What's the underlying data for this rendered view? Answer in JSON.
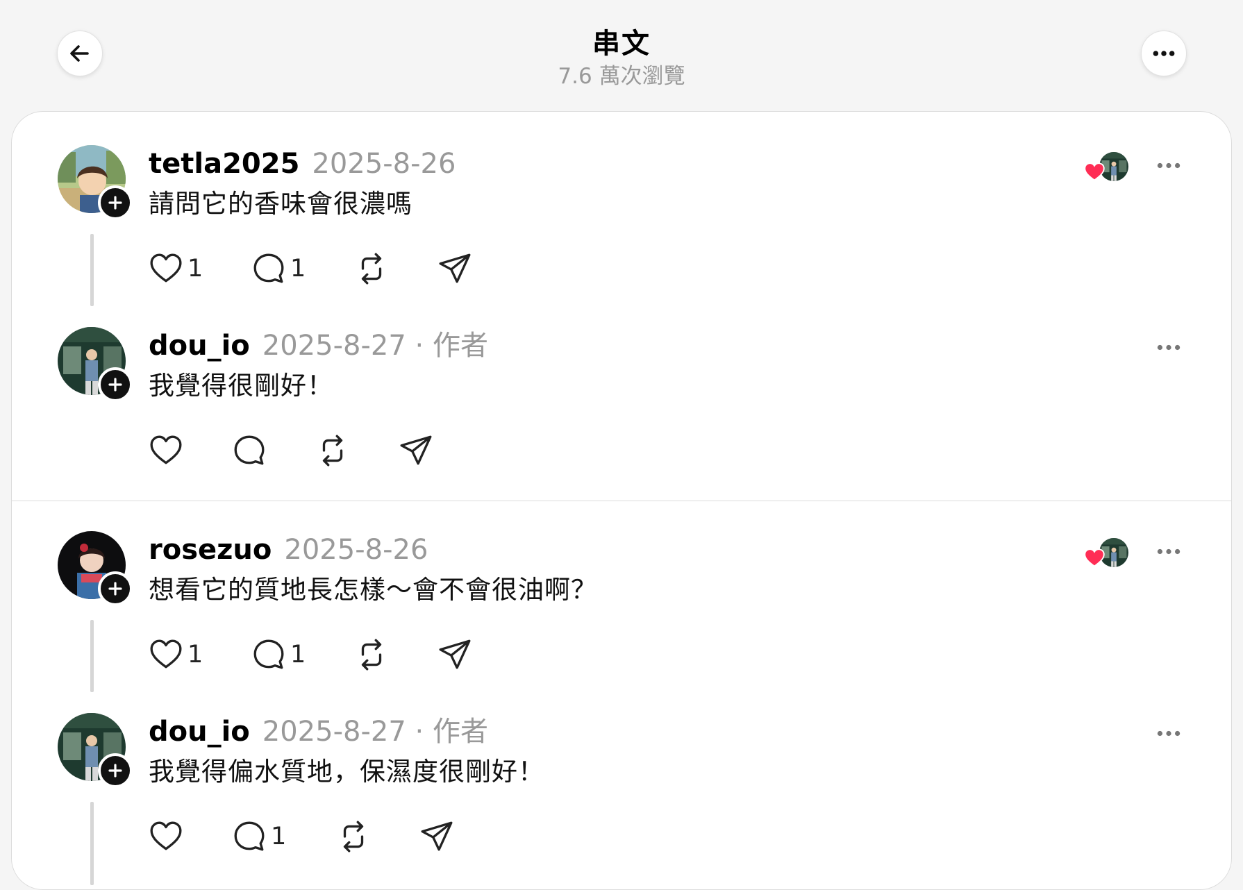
{
  "header": {
    "title": "串文",
    "subtitle": "7.6 萬次瀏覽",
    "back_icon": "arrow-left-icon",
    "more_icon": "ellipsis-icon"
  },
  "colors": {
    "heart_red": "#ff2d55",
    "muted_text": "#999999",
    "thread_line": "#d6d6d6"
  },
  "comments": [
    {
      "username": "tetla2025",
      "date": "2025-8-26",
      "author_tag": "",
      "text": "請問它的香味會很濃嗎",
      "like_count": "1",
      "reply_count": "1",
      "liked_by_author": true,
      "avatar": "anime-boy-avatar"
    },
    {
      "username": "dou_io",
      "date": "2025-8-27",
      "author_tag": " · 作者",
      "text": "我覺得很剛好！",
      "like_count": "",
      "reply_count": "",
      "liked_by_author": false,
      "avatar": "storefront-person-avatar"
    },
    {
      "username": "rosezuo",
      "date": "2025-8-26",
      "author_tag": "",
      "text": "想看它的質地長怎樣～會不會很油啊？",
      "like_count": "1",
      "reply_count": "1",
      "liked_by_author": true,
      "avatar": "girl-avatar"
    },
    {
      "username": "dou_io",
      "date": "2025-8-27",
      "author_tag": " · 作者",
      "text": "我覺得偏水質地，保濕度很剛好！",
      "like_count": "",
      "reply_count": "1",
      "liked_by_author": false,
      "avatar": "storefront-person-avatar"
    }
  ]
}
